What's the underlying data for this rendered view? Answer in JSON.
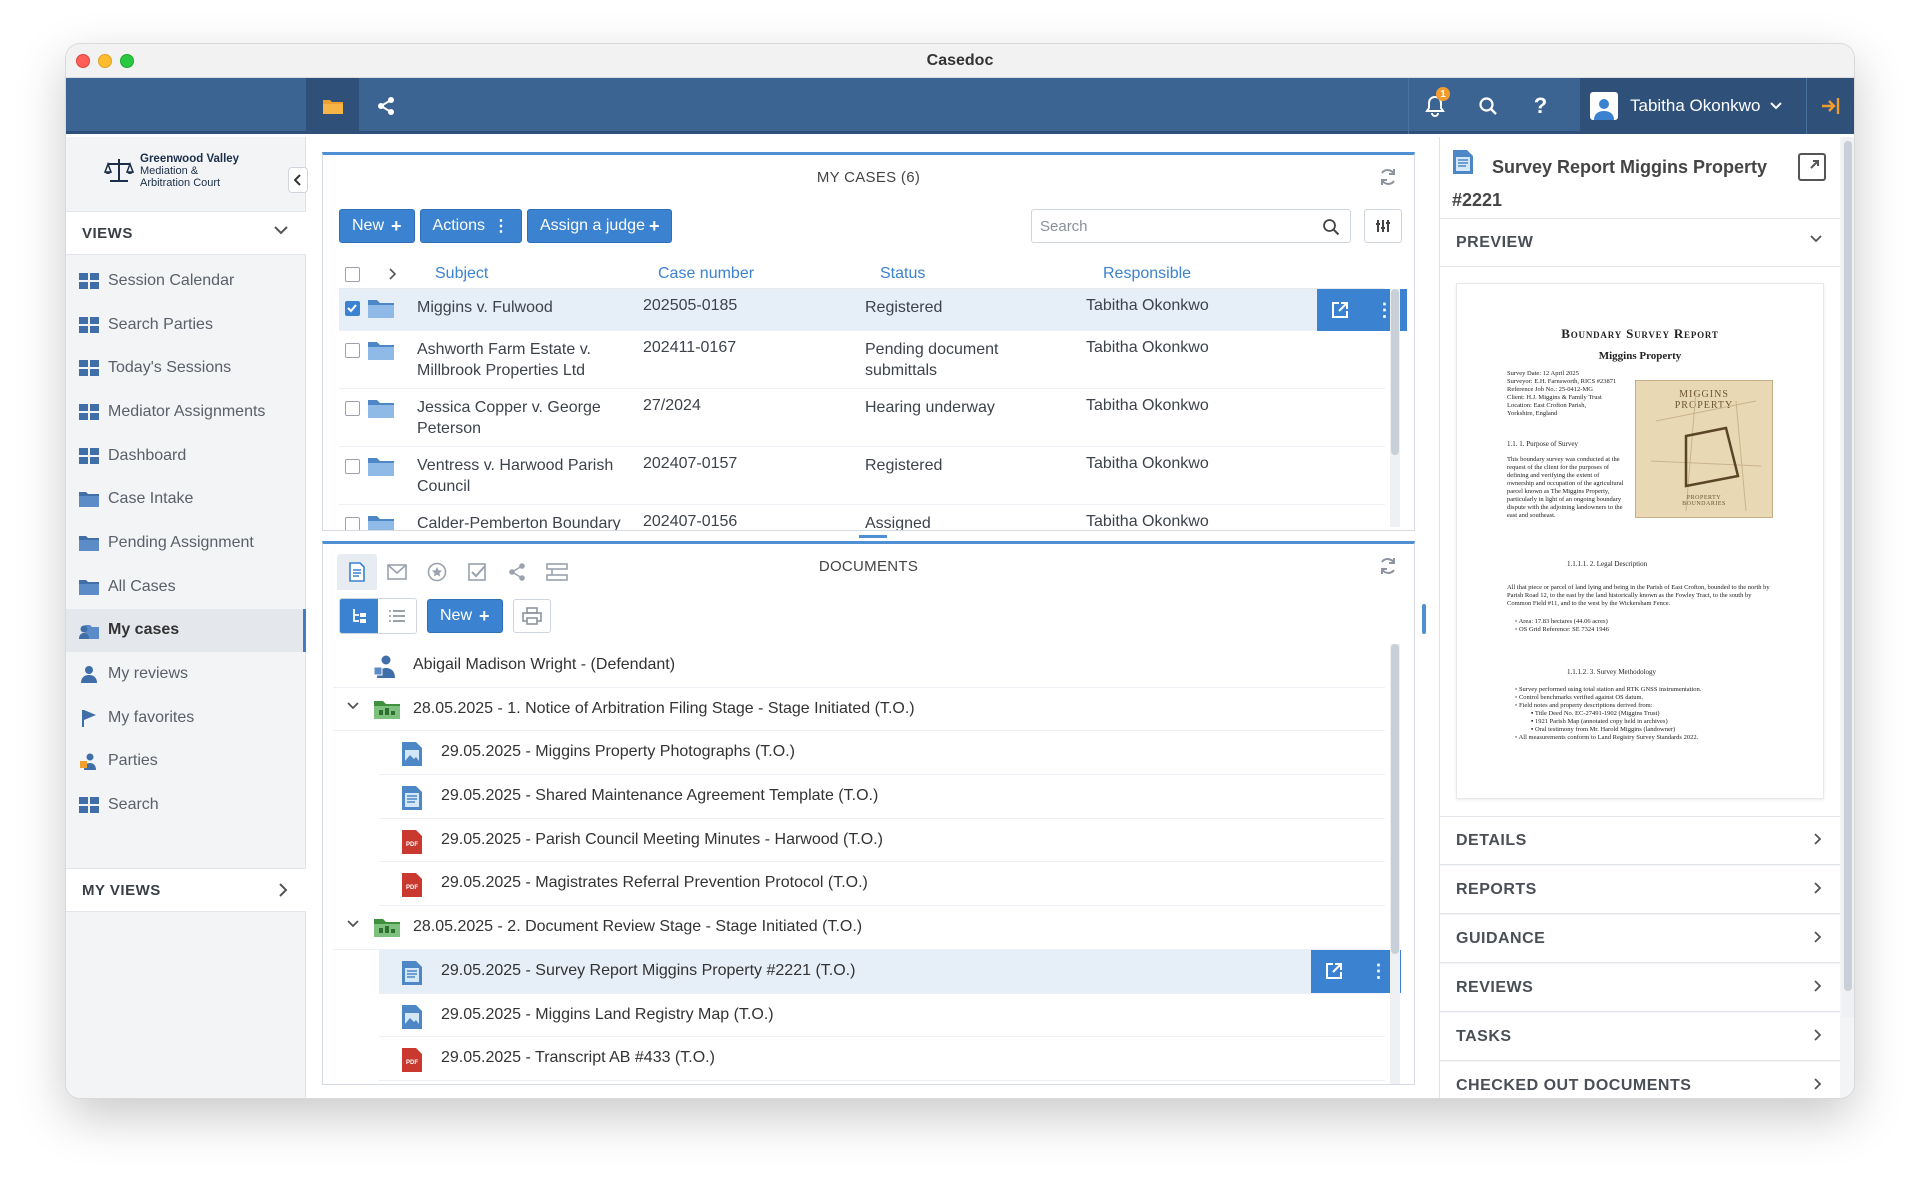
{
  "window": {
    "title": "Casedoc"
  },
  "topbar": {
    "notifications_count": "1",
    "user_name": "Tabitha Okonkwo"
  },
  "sidebar": {
    "logo": {
      "line1": "Greenwood Valley",
      "line2": "Mediation &",
      "line3": "Arbitration Court"
    },
    "views_label": "VIEWS",
    "items": [
      {
        "label": "Session Calendar",
        "icon": "grid-icon"
      },
      {
        "label": "Search Parties",
        "icon": "grid-icon"
      },
      {
        "label": "Today's Sessions",
        "icon": "grid-icon"
      },
      {
        "label": "Mediator Assignments",
        "icon": "grid-icon"
      },
      {
        "label": "Dashboard",
        "icon": "grid-icon"
      },
      {
        "label": "Case Intake",
        "icon": "folder-icon"
      },
      {
        "label": "Pending Assignment",
        "icon": "folder-icon"
      },
      {
        "label": "All Cases",
        "icon": "folder-icon"
      },
      {
        "label": "My cases",
        "icon": "user-folder-icon"
      },
      {
        "label": "My reviews",
        "icon": "user-icon"
      },
      {
        "label": "My favorites",
        "icon": "flag-icon"
      },
      {
        "label": "Parties",
        "icon": "parties-icon"
      },
      {
        "label": "Search",
        "icon": "grid-icon"
      }
    ],
    "my_views_label": "MY VIEWS"
  },
  "cases": {
    "title": "MY CASES (6)",
    "buttons": {
      "new": "New",
      "actions": "Actions",
      "assign": "Assign a judge"
    },
    "search_placeholder": "Search",
    "columns": {
      "subject": "Subject",
      "case_number": "Case number",
      "status": "Status",
      "responsible": "Responsible"
    },
    "rows": [
      {
        "subject": "Miggins v. Fulwood",
        "case_number": "202505-0185",
        "status": "Registered",
        "responsible": "Tabitha Okonkwo"
      },
      {
        "subject": "Ashworth Farm Estate v. Millbrook Properties Ltd",
        "case_number": "202411-0167",
        "status": "Pending document submittals",
        "responsible": "Tabitha Okonkwo"
      },
      {
        "subject": "Jessica Copper v. George Peterson",
        "case_number": "27/2024",
        "status": "Hearing underway",
        "responsible": "Tabitha Okonkwo"
      },
      {
        "subject": "Ventress v. Harwood Parish Council",
        "case_number": "202407-0157",
        "status": "Registered",
        "responsible": "Tabitha Okonkwo"
      },
      {
        "subject": "Calder-Pemberton Boundary",
        "case_number": "202407-0156",
        "status": "Assigned",
        "responsible": "Tabitha Okonkwo"
      }
    ]
  },
  "documents": {
    "title": "DOCUMENTS",
    "new_label": "New",
    "tree": [
      {
        "level": 0,
        "label": "Abigail Madison Wright - (Defendant)",
        "icon": "party-icon"
      },
      {
        "level": 0,
        "label": "28.05.2025 - 1. Notice of Arbitration Filing Stage - Stage Initiated (T.O.)",
        "icon": "stage-folder-icon"
      },
      {
        "level": 1,
        "label": "29.05.2025 - Miggins Property Photographs (T.O.)",
        "icon": "image-doc-icon"
      },
      {
        "level": 1,
        "label": "29.05.2025 - Shared Maintenance Agreement Template (T.O.)",
        "icon": "doc-icon"
      },
      {
        "level": 1,
        "label": "29.05.2025 - Parish Council Meeting Minutes - Harwood (T.O.)",
        "icon": "pdf-icon"
      },
      {
        "level": 1,
        "label": "29.05.2025 - Magistrates Referral Prevention Protocol (T.O.)",
        "icon": "pdf-icon"
      },
      {
        "level": 0,
        "label": "28.05.2025 - 2. Document Review Stage - Stage Initiated (T.O.)",
        "icon": "stage-folder-icon"
      },
      {
        "level": 1,
        "label": "29.05.2025 - Survey Report Miggins Property #2221 (T.O.)",
        "icon": "doc-icon"
      },
      {
        "level": 1,
        "label": "29.05.2025 - Miggins Land Registry Map (T.O.)",
        "icon": "image-doc-icon"
      },
      {
        "level": 1,
        "label": "29.05.2025 - Transcript AB #433 (T.O.)",
        "icon": "pdf-icon"
      }
    ]
  },
  "details_panel": {
    "doc_title": "Survey Report Miggins Property #2221",
    "preview_label": "PREVIEW",
    "preview": {
      "title": "Boundary Survey Report",
      "subtitle": "Miggins Property",
      "meta": [
        "Survey Date: 12 April 2025",
        "Surveyor: E.H. Farnsworth, RICS #23871",
        "Reference Job No.: 25-0412-MG",
        "Client: H.J. Miggins & Family Trust",
        "Location: East Crofton Parish,",
        "Yorkshire, England"
      ],
      "map_title": "MIGGINS PROPERTY",
      "map_caption": "PROPERTY BOUNDARIES",
      "section1": "1.1.    1. Purpose of Survey",
      "para1": "This boundary survey was conducted at the request of the client for the purposes of defining and verifying the extent of ownership and occupation of the agricultural parcel known as The Miggins Property, particularly in light of an ongoing boundary dispute with the adjoining landowners to the east and southeast.",
      "section2": "1.1.1.1.    2. Legal Description",
      "para2": "All that piece or parcel of land lying and being in the Parish of East Crofton, bounded to the north by Parish Road 12, to the east by the land historically known as the Fowley Tract, to the south by Common Field #11, and to the west by the Wickersham Fence.",
      "bullets2": [
        "Area: 17.83 hectares (44.06 acres)",
        "OS Grid Reference: SE 7324 1946"
      ],
      "section3": "1.1.1.2.    3. Survey Methodology",
      "bullets3": [
        "Survey performed using total station and RTK GNSS instrumentation.",
        "Control benchmarks verified against OS datum.",
        "Field notes and property descriptions derived from:",
        "Title Deed No. EC-27491-1902 (Miggins Trust)",
        "1921 Parish Map (annotated copy held in archives)",
        "Oral testimony from Mr. Harold Miggins (landowner)",
        "All measurements conform to Land Registry Survey Standards 2022."
      ]
    },
    "sections": [
      "DETAILS",
      "REPORTS",
      "GUIDANCE",
      "REVIEWS",
      "TASKS",
      "CHECKED OUT DOCUMENTS"
    ]
  }
}
